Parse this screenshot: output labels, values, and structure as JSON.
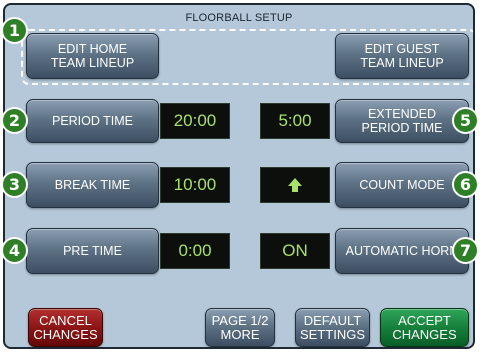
{
  "title": "FLOORBALL SETUP",
  "badges": [
    "1",
    "2",
    "3",
    "4",
    "5",
    "6",
    "7"
  ],
  "lineup": {
    "home": [
      "EDIT HOME",
      "TEAM LINEUP"
    ],
    "guest": [
      "EDIT GUEST",
      "TEAM LINEUP"
    ]
  },
  "settings": {
    "period_time": {
      "label": "PERIOD TIME",
      "value": "20:00"
    },
    "break_time": {
      "label": "BREAK TIME",
      "value": "10:00"
    },
    "pre_time": {
      "label": "PRE TIME",
      "value": "0:00"
    },
    "extended_period_time": {
      "label": [
        "EXTENDED",
        "PERIOD TIME"
      ],
      "value": "5:00"
    },
    "count_mode": {
      "label": "COUNT MODE",
      "value": "up-arrow-icon"
    },
    "automatic_horn": {
      "label": "AUTOMATIC HORN",
      "value": "ON"
    }
  },
  "footer": {
    "cancel": [
      "CANCEL",
      "CHANGES"
    ],
    "page": [
      "PAGE 1/2",
      "MORE"
    ],
    "default": [
      "DEFAULT",
      "SETTINGS"
    ],
    "accept": [
      "ACCEPT",
      "CHANGES"
    ]
  },
  "colors": {
    "screen_bg": "#b4c8d9",
    "display_text": "#a8e06a",
    "badge": "#2e7f25",
    "cancel": "#8c1515",
    "accept": "#16803b"
  }
}
